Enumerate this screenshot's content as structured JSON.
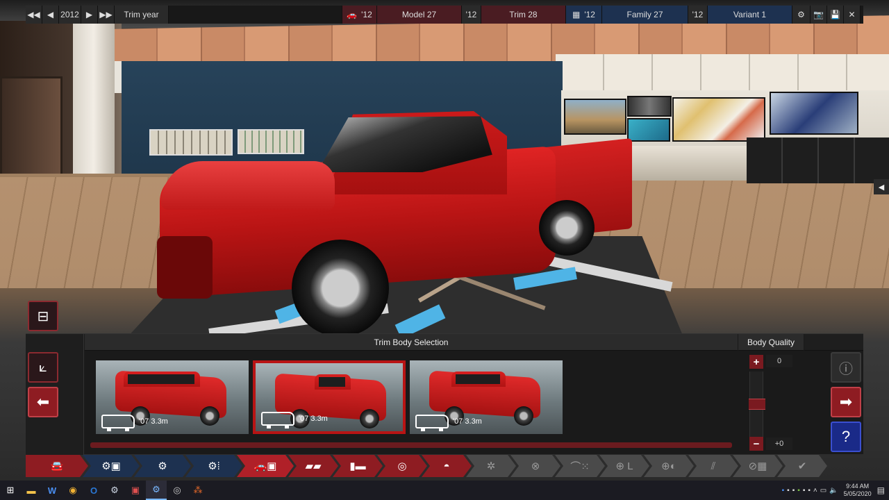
{
  "topbar": {
    "year": "2012",
    "year_label": "Trim year",
    "model_year": "'12",
    "model_name": "Model 27",
    "trim_year": "'12",
    "trim_name": "Trim 28",
    "family_year": "'12",
    "family_name": "Family 27",
    "variant_year": "'12",
    "variant_name": "Variant 1"
  },
  "panel": {
    "title": "Trim Body Selection",
    "quality_title": "Body Quality",
    "quality_value": "0",
    "quality_delta": "+0",
    "quality_slider_fraction": 0.5,
    "trims": [
      {
        "label": "'07 3.3m",
        "style": "suv",
        "selected": false
      },
      {
        "label": "'07 3.3m",
        "style": "pickup",
        "selected": true
      },
      {
        "label": "'07 3.3m",
        "style": "crew-cab",
        "selected": false
      }
    ]
  },
  "nav": [
    {
      "icon": "car-icon",
      "state": "red"
    },
    {
      "icon": "engine-folder-icon",
      "state": "blue"
    },
    {
      "icon": "engine-block-icon",
      "state": "blue"
    },
    {
      "icon": "engine-tuning-icon",
      "state": "blue"
    },
    {
      "icon": "car-trim-icon",
      "state": "active"
    },
    {
      "icon": "car-body-icon",
      "state": "red"
    },
    {
      "icon": "chassis-icon",
      "state": "red"
    },
    {
      "icon": "gauge-icon",
      "state": "red"
    },
    {
      "icon": "speedometer-icon",
      "state": "red"
    },
    {
      "icon": "wheel-icon",
      "state": "grey"
    },
    {
      "icon": "disc-icon",
      "state": "grey"
    },
    {
      "icon": "car-paint-icon",
      "state": "grey"
    },
    {
      "icon": "steering-seat-icon",
      "state": "grey"
    },
    {
      "icon": "steering-wheel-icon",
      "state": "grey"
    },
    {
      "icon": "road-icon",
      "state": "grey"
    },
    {
      "icon": "finish-flag-icon",
      "state": "grey"
    },
    {
      "icon": "checkmark-icon",
      "state": "grey"
    }
  ],
  "taskbar": {
    "time": "9:44 AM",
    "date": "5/05/2020"
  },
  "colors": {
    "accent_red": "#8e1c22",
    "accent_navy": "#1d3150",
    "selected_border": "#b81414"
  }
}
